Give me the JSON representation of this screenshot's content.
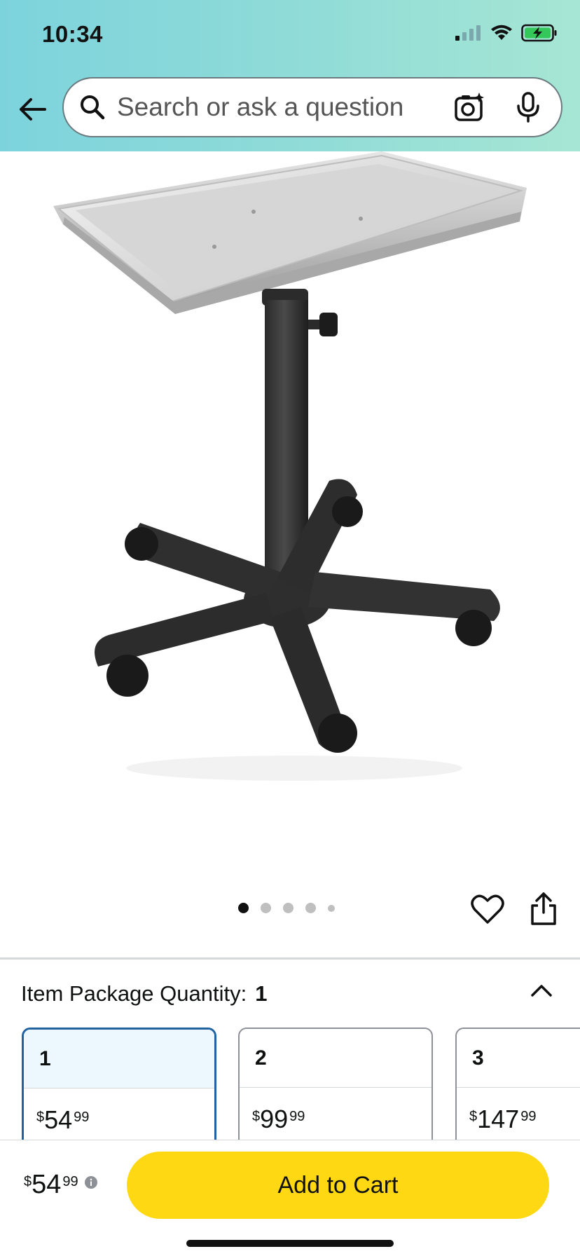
{
  "status_bar": {
    "time": "10:34"
  },
  "search": {
    "placeholder": "Search or ask a question"
  },
  "gallery": {
    "image_count": 5,
    "active_index": 0
  },
  "quantity": {
    "label": "Item Package Quantity:",
    "selected_value": "1",
    "options": [
      {
        "qty": "1",
        "currency": "$",
        "whole": "54",
        "fraction": "99",
        "selected": true
      },
      {
        "qty": "2",
        "currency": "$",
        "whole": "99",
        "fraction": "99",
        "selected": false
      },
      {
        "qty": "3",
        "currency": "$",
        "whole": "147",
        "fraction": "99",
        "selected": false
      }
    ]
  },
  "buy_bar": {
    "currency": "$",
    "whole": "54",
    "fraction": "99",
    "add_to_cart_label": "Add to Cart"
  },
  "colors": {
    "header_start": "#7dd3dc",
    "header_end": "#a6e6d4",
    "add_to_cart": "#ffd814",
    "selected_border": "#2162a1"
  },
  "icons": [
    "back-arrow-icon",
    "search-icon",
    "camera-icon",
    "mic-icon",
    "heart-icon",
    "share-icon",
    "chevron-up-icon",
    "info-icon"
  ]
}
